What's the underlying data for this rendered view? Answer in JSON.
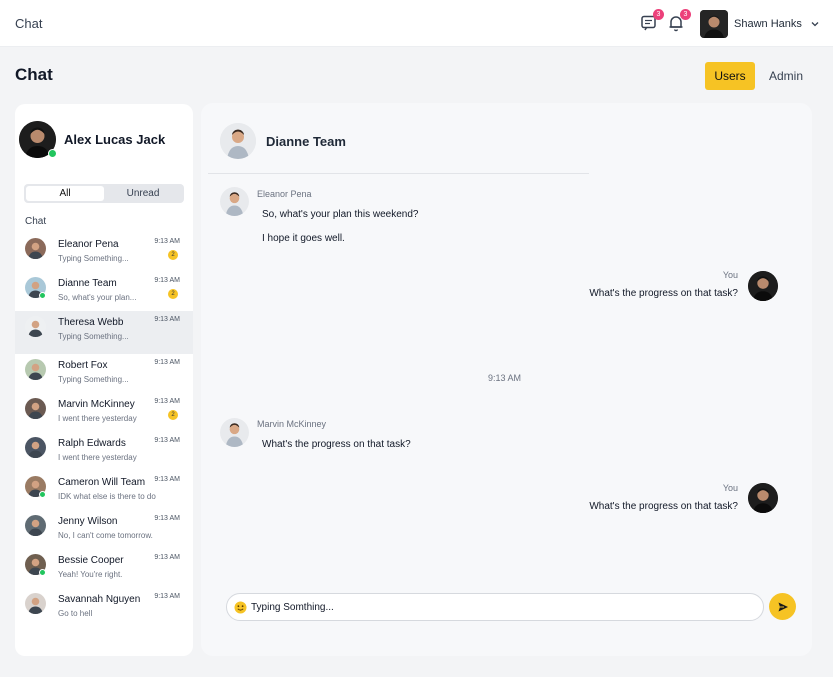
{
  "topbar": {
    "title": "Chat",
    "messages_badge": "3",
    "notifications_badge": "3",
    "user_name": "Shawn Hanks"
  },
  "page": {
    "heading": "Chat",
    "tabs": [
      "Users",
      "Admin"
    ],
    "active_tab": "Users"
  },
  "sidebar": {
    "me_name": "Alex Lucas Jack",
    "me_online": true,
    "filters": [
      "All",
      "Unread"
    ],
    "active_filter": "All",
    "list_label": "Chat",
    "contacts": [
      {
        "name": "Eleanor Pena",
        "preview": "Typing Something...",
        "time": "9:13 AM",
        "unread": "2",
        "online": false
      },
      {
        "name": "Dianne Team",
        "preview": "So, what's your plan...",
        "time": "9:13 AM",
        "unread": "2",
        "online": true
      },
      {
        "name": "Theresa Webb",
        "preview": "Typing Something...",
        "time": "9:13 AM",
        "unread": "",
        "online": false,
        "active": true
      },
      {
        "name": "Robert Fox",
        "preview": "Typing Something...",
        "time": "9:13 AM",
        "unread": "",
        "online": false
      },
      {
        "name": "Marvin McKinney",
        "preview": "I went there yesterday",
        "time": "9:13 AM",
        "unread": "2",
        "online": false
      },
      {
        "name": "Ralph Edwards",
        "preview": "I went there yesterday",
        "time": "9:13 AM",
        "unread": "",
        "online": false
      },
      {
        "name": "Cameron Will Team",
        "preview": "IDK what else is there to do",
        "time": "9:13 AM",
        "unread": "",
        "online": true
      },
      {
        "name": "Jenny Wilson",
        "preview": "No, I can't come tomorrow.",
        "time": "9:13 AM",
        "unread": "",
        "online": false
      },
      {
        "name": "Bessie Cooper",
        "preview": "Yeah! You're right.",
        "time": "9:13 AM",
        "unread": "",
        "online": true
      },
      {
        "name": "Savannah Nguyen",
        "preview": "Go to hell",
        "time": "9:13 AM",
        "unread": "",
        "online": false
      }
    ]
  },
  "chat": {
    "title": "Dianne Team",
    "messages": [
      {
        "sender": "Eleanor Pena",
        "lines": [
          "So, what's your plan this weekend?",
          "I hope it goes well."
        ]
      },
      {
        "sender": "You",
        "lines": [
          "What's the progress on that task?"
        ]
      },
      {
        "time_separator": "9:13 AM"
      },
      {
        "sender": "Marvin McKinney",
        "lines": [
          "What's the progress on that task?"
        ]
      },
      {
        "sender": "You",
        "lines": [
          "What's the progress on that task?"
        ]
      }
    ],
    "composer_value": "Typing Somthing..."
  },
  "colors": {
    "accent": "#f6c324",
    "badge": "#ec407a",
    "online": "#22c55e"
  },
  "icons": [
    "messages-icon",
    "bell-icon",
    "chevron-down-icon",
    "emoji-icon",
    "send-icon"
  ]
}
